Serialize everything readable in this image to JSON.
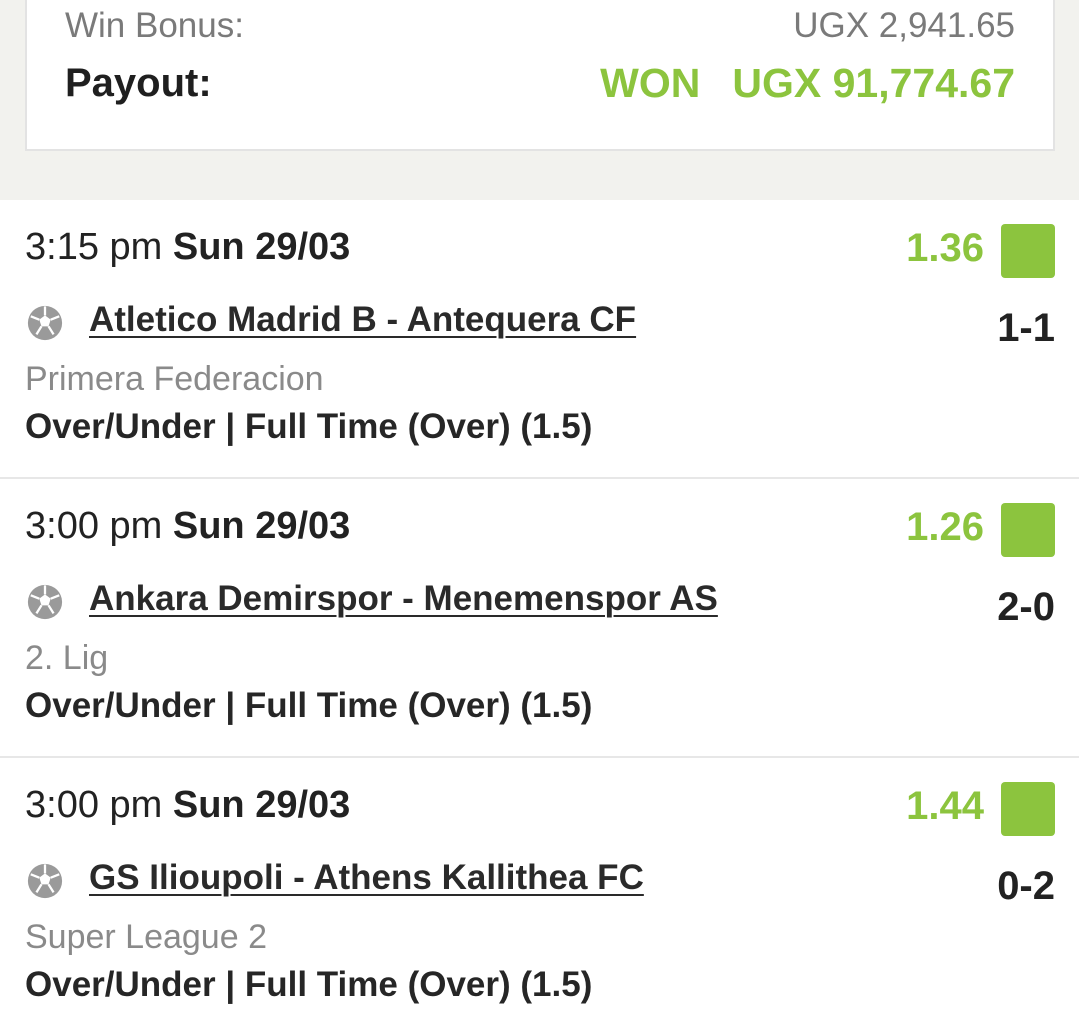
{
  "summary": {
    "win_bonus_label": "Win Bonus:",
    "win_bonus_value": "UGX 2,941.65",
    "payout_label": "Payout:",
    "payout_status": "WON",
    "payout_value": "UGX 91,774.67"
  },
  "colors": {
    "accent_green": "#8cc43e",
    "background": "#f2f2ee"
  },
  "matches": [
    {
      "time": "3:15 pm",
      "date": "Sun 29/03",
      "odds": "1.36",
      "teams": "Atletico Madrid B - Antequera CF",
      "score": "1-1",
      "league": "Primera Federacion",
      "market": "Over/Under | Full Time (Over) (1.5)",
      "status_icon": "won-square",
      "sport_icon": "soccer-ball-icon"
    },
    {
      "time": "3:00 pm",
      "date": "Sun 29/03",
      "odds": "1.26",
      "teams": "Ankara Demirspor - Menemenspor AS",
      "score": "2-0",
      "league": "2. Lig",
      "market": "Over/Under | Full Time (Over) (1.5)",
      "status_icon": "won-square",
      "sport_icon": "soccer-ball-icon"
    },
    {
      "time": "3:00 pm",
      "date": "Sun 29/03",
      "odds": "1.44",
      "teams": "GS Ilioupoli - Athens Kallithea FC",
      "score": "0-2",
      "league": "Super League 2",
      "market": "Over/Under | Full Time (Over) (1.5)",
      "status_icon": "won-square",
      "sport_icon": "soccer-ball-icon"
    }
  ]
}
